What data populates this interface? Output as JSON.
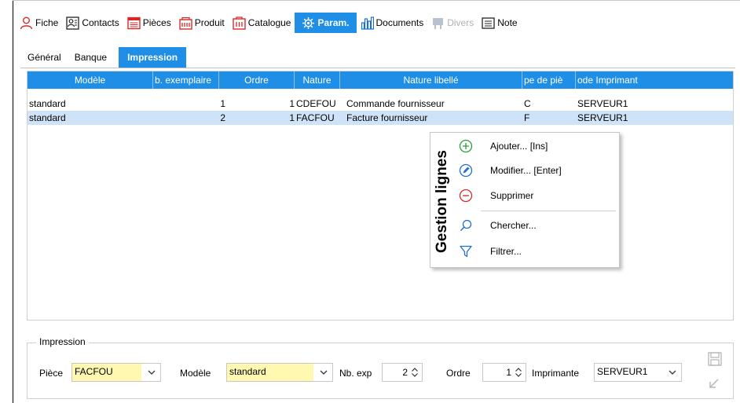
{
  "toolbar": {
    "items": [
      {
        "label": "Fiche",
        "icon": "person-icon"
      },
      {
        "label": "Contacts",
        "icon": "contacts-icon"
      },
      {
        "label": "Pièces",
        "icon": "document-list-icon"
      },
      {
        "label": "Produit",
        "icon": "product-icon"
      },
      {
        "label": "Catalogue",
        "icon": "catalogue-icon"
      },
      {
        "label": "Param.",
        "icon": "gear-icon"
      },
      {
        "label": "Documents",
        "icon": "chart-bars-icon"
      },
      {
        "label": "Divers",
        "icon": "misc-icon"
      },
      {
        "label": "Note",
        "icon": "note-icon"
      }
    ],
    "active": "Param.",
    "disabled": "Divers"
  },
  "subtabs": {
    "items": [
      "Général",
      "Banque",
      "Impression"
    ],
    "active": "Impression"
  },
  "grid": {
    "columns": [
      "Modèle",
      "b. exemplaire",
      "Ordre",
      "Nature",
      "Nature libellé",
      "pe de piè",
      "ode Imprimant"
    ],
    "rows": [
      {
        "modele": "standard",
        "nb": "1",
        "ordre": "1",
        "nature": "CDEFOU",
        "libelle": "Commande fournisseur",
        "type": "C",
        "imprimante": "SERVEUR1"
      },
      {
        "modele": "standard",
        "nb": "2",
        "ordre": "1",
        "nature": "FACFOU",
        "libelle": "Facture fournisseur",
        "type": "F",
        "imprimante": "SERVEUR1"
      }
    ]
  },
  "context_menu": {
    "title": "Gestion lignes",
    "items": [
      {
        "label": "Ajouter... [Ins]",
        "icon": "add-circle-icon"
      },
      {
        "label": "Modifier... [Enter]",
        "icon": "edit-circle-icon"
      },
      {
        "label": "Supprimer",
        "icon": "remove-circle-icon"
      },
      {
        "label": "Chercher...",
        "icon": "search-icon"
      },
      {
        "label": "Filtrer...",
        "icon": "filter-icon"
      }
    ]
  },
  "impression": {
    "title": "Impression",
    "piece_label": "Pièce",
    "piece_value": "FACFOU",
    "modele_label": "Modèle",
    "modele_value": "standard",
    "nbexp_label": "Nb. exp",
    "nbexp_value": "2",
    "ordre_label": "Ordre",
    "ordre_value": "1",
    "imprimante_label": "Imprimante",
    "imprimante_value": "SERVEUR1"
  },
  "colors": {
    "accent": "#1e8ee6",
    "selected_row": "#cfe3f8",
    "required_field": "#fff8b0",
    "icon_red": "#d62a2a",
    "icon_green": "#2a9d3a",
    "icon_blue": "#1e6fd0"
  }
}
